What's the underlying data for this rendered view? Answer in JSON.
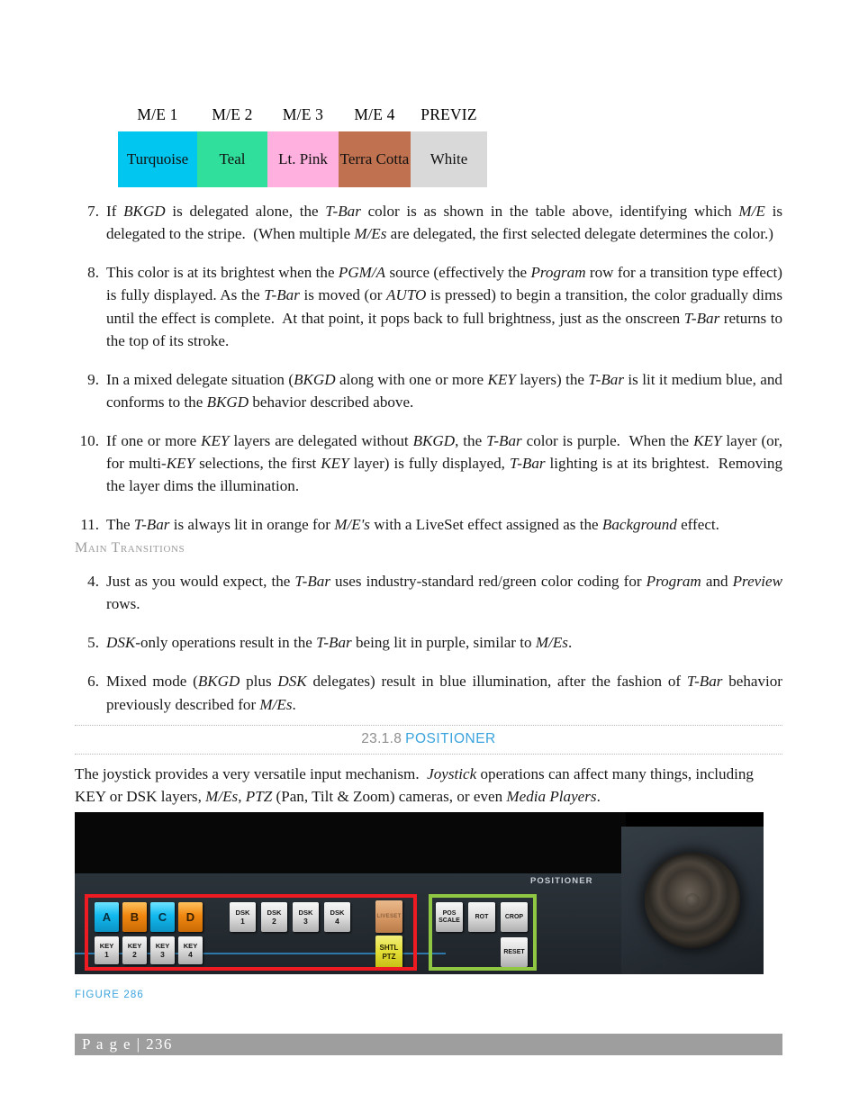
{
  "table": {
    "headers": [
      "M/E 1",
      "M/E 2",
      "M/E 3",
      "M/E 4",
      "PREVIZ"
    ],
    "cells": [
      {
        "label": "Turquoise",
        "color": "#00c6f0"
      },
      {
        "label": "Teal",
        "color": "#2fdf9b"
      },
      {
        "label": "Lt. Pink",
        "color": "#ffb0de"
      },
      {
        "label": "Terra Cotta",
        "color": "#c0714f"
      },
      {
        "label": "White",
        "color": "#d9d9d9"
      }
    ]
  },
  "list_one": [
    {
      "num": "7.",
      "html": "If <i>BKGD</i> is delegated alone, the <i>T-Bar</i> color is as shown in the table above, identifying which <i>M/E</i> is delegated to the stripe.&nbsp; (When multiple <i>M/Es</i> are delegated, the first selected delegate determines the color.)"
    },
    {
      "num": "8.",
      "html": "This color is at its brightest when the <i>PGM/A</i> source (effectively the <i>Program</i> row for a transition type effect) is fully displayed. As the <i>T-Bar</i> is moved (or <i>AUTO</i> is pressed) to begin a transition, the color gradually dims until the effect is complete.&nbsp; At that point, it pops back to full brightness, just as the onscreen <i>T-Bar</i> returns to the top of its stroke."
    },
    {
      "num": "9.",
      "html": "In a mixed delegate situation (<i>BKGD</i> along with one or more <i>KEY</i> layers) the <i>T-Bar</i> is lit it medium blue, and conforms to the <i>BKGD</i> behavior described above."
    },
    {
      "num": "10.",
      "html": "If one or more <i>KEY</i> layers are delegated without <i>BKGD</i>, the <i>T-Bar</i> color is purple.&nbsp; When the <i>KEY</i> layer (or, for multi-<i>KEY</i> selections, the first <i>KEY</i> layer) is fully displayed, <i>T-Bar</i> lighting is at its brightest.&nbsp; Removing the layer dims the illumination."
    },
    {
      "num": "11.",
      "html": "The <i>T-Bar</i> is always lit in orange for <i>M/E's</i> with a LiveSet effect assigned as the <i>Background</i> effect."
    }
  ],
  "subheading": "Main Transitions",
  "list_two": [
    {
      "num": "4.",
      "html": "Just as you would expect, the <i>T-Bar</i> uses industry-standard red/green color coding for <i>Program</i> and <i>Preview</i> rows."
    },
    {
      "num": "5.",
      "html": "<i>DSK</i>-only operations result in the <i>T-Bar</i> being lit in purple, similar to <i>M/Es</i>."
    },
    {
      "num": "6.",
      "html": "Mixed mode (<i>BKGD</i> plus <i>DSK</i> delegates) result in blue illumination, after the fashion of <i>T-Bar</i> behavior previously described for <i>M/Es</i>."
    }
  ],
  "section": {
    "number": "23.1.8",
    "title": "POSITIONER",
    "title_color": "#3aa3dd"
  },
  "intro_paragraph": {
    "html": "The joystick provides a very versatile input mechanism.&nbsp; <i>Joystick</i> operations can affect many things, including KEY or DSK layers, <i>M/Es</i>, <i>PTZ</i> (Pan, Tilt &amp; Zoom) cameras, or even <i>Media Players</i>."
  },
  "figure": {
    "caption": "FIGURE 286",
    "panel_label": "POSITIONER",
    "highlight_red": "#ee1c22",
    "highlight_green": "#8fc742",
    "buses": [
      {
        "label": "A",
        "state": "cyan"
      },
      {
        "label": "B",
        "state": "orange"
      },
      {
        "label": "C",
        "state": "cyan"
      },
      {
        "label": "D",
        "state": "orange"
      }
    ],
    "keys": [
      {
        "l1": "KEY",
        "l2": "1"
      },
      {
        "l1": "KEY",
        "l2": "2"
      },
      {
        "l1": "KEY",
        "l2": "3"
      },
      {
        "l1": "KEY",
        "l2": "4"
      }
    ],
    "dsks": [
      {
        "l1": "DSK",
        "l2": "1"
      },
      {
        "l1": "DSK",
        "l2": "2"
      },
      {
        "l1": "DSK",
        "l2": "3"
      },
      {
        "l1": "DSK",
        "l2": "4"
      }
    ],
    "liveset": {
      "label": "LIVESET"
    },
    "shuttle": {
      "l1": "SHTL",
      "l2": "PTZ"
    },
    "positioner_buttons": [
      {
        "l1": "POS",
        "l2": "SCALE"
      },
      {
        "l1": "ROT",
        "l2": ""
      },
      {
        "l1": "CROP",
        "l2": ""
      },
      {
        "l1": "RESET",
        "l2": ""
      }
    ]
  },
  "footer": {
    "page_label": "P a g e  |  236"
  }
}
